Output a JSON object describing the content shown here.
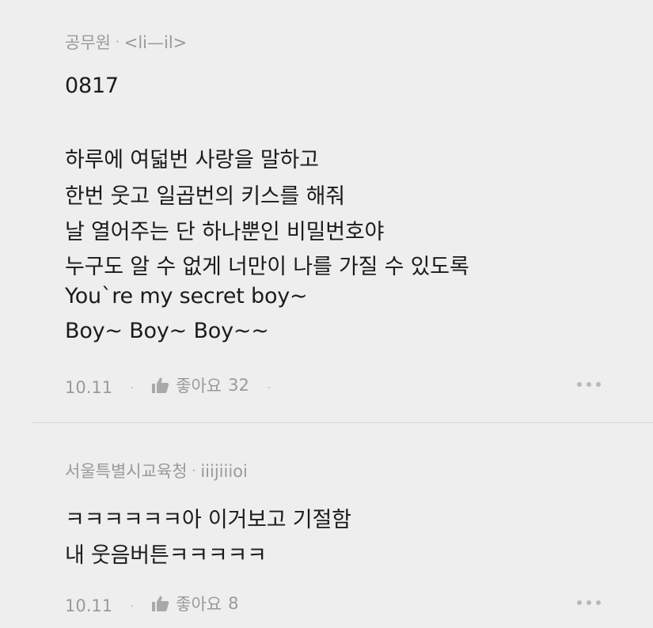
{
  "comments": [
    {
      "author": "공무원",
      "separator": "·",
      "handle": "<li—il>",
      "lines": [
        "0817",
        "하루에 여덟번 사랑을 말하고",
        "한번 웃고 일곱번의 키스를 해줘",
        "날 열어주는 단 하나뿐인 비밀번호야",
        "누구도 알 수 없게 너만이 나를 가질 수 있도록",
        "You`re my secret boy~",
        "Boy~ Boy~ Boy~~"
      ],
      "date": "10.11",
      "like_label": "좋아요",
      "like_count": "32"
    },
    {
      "author": "서울특별시교육청",
      "separator": "·",
      "handle": "iiijiiioi",
      "lines": [
        "ㅋㅋㅋㅋㅋㅋ아 이거보고 기절함",
        "내 웃음버튼ㅋㅋㅋㅋㅋ"
      ],
      "date": "10.11",
      "like_label": "좋아요",
      "like_count": "8"
    }
  ],
  "icons": {
    "like": "thumbs-up-icon",
    "more": "more-options-icon"
  },
  "colors": {
    "background": "#eeeeee",
    "text": "#1b1b1b",
    "meta": "#9a9a9a",
    "divider": "#d8d8d8"
  }
}
